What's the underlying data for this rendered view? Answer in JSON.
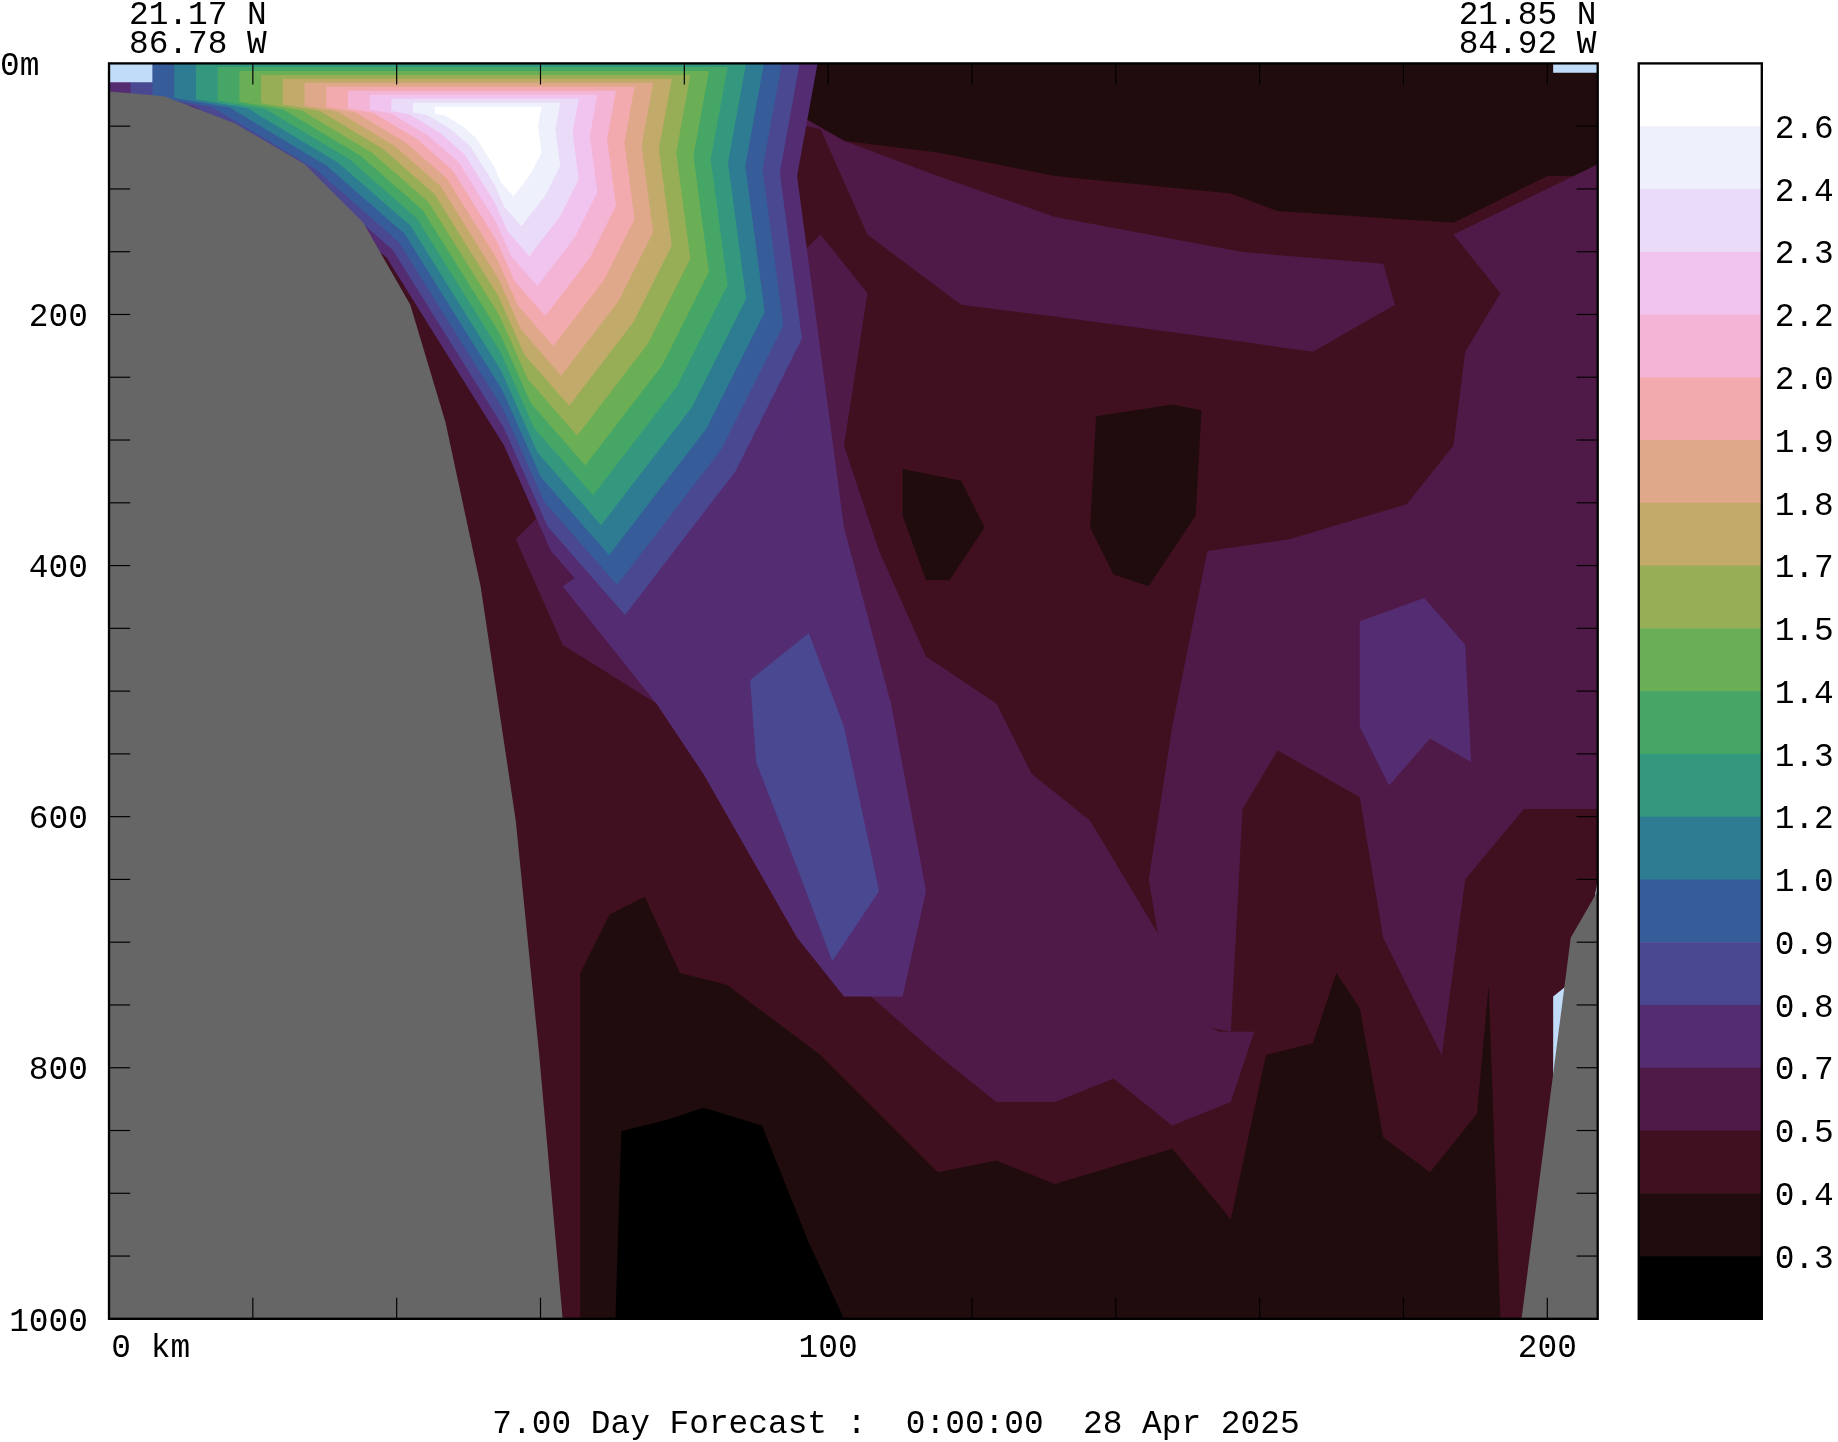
{
  "header": {
    "start": {
      "latitude": "21.17 N",
      "longitude": "86.78 W"
    },
    "end": {
      "latitude": "21.85 N",
      "longitude": "84.92 W"
    }
  },
  "plot": {
    "y_axis_labels": [
      "0m",
      "200",
      "400",
      "600",
      "800",
      "1000"
    ],
    "x_axis_labels": [
      "0 km",
      "100",
      "200"
    ]
  },
  "colorbar": {
    "bands": [
      {
        "color": "#ffffff"
      },
      {
        "color": "#eef0fc"
      },
      {
        "color": "#eadcf8"
      },
      {
        "color": "#f0c4ee"
      },
      {
        "color": "#f4b4d6"
      },
      {
        "color": "#f2aaae"
      },
      {
        "color": "#e0a88a"
      },
      {
        "color": "#c2aa6a"
      },
      {
        "color": "#98ae56"
      },
      {
        "color": "#6aae56"
      },
      {
        "color": "#46a666"
      },
      {
        "color": "#34987e"
      },
      {
        "color": "#2e7c92"
      },
      {
        "color": "#365c9a"
      },
      {
        "color": "#4a4890"
      },
      {
        "color": "#542c72"
      },
      {
        "color": "#501a48"
      },
      {
        "color": "#401020"
      },
      {
        "color": "#200c0c"
      },
      {
        "color": "#000000"
      }
    ],
    "labels": [
      "2.6",
      "2.4",
      "2.3",
      "2.2",
      "2.0",
      "1.9",
      "1.8",
      "1.7",
      "1.5",
      "1.4",
      "1.3",
      "1.2",
      "1.0",
      "0.9",
      "0.8",
      "0.7",
      "0.5",
      "0.4",
      "0.3"
    ]
  },
  "footer": "7.00 Day Forecast :  0:00:00  28 Apr 2025"
}
